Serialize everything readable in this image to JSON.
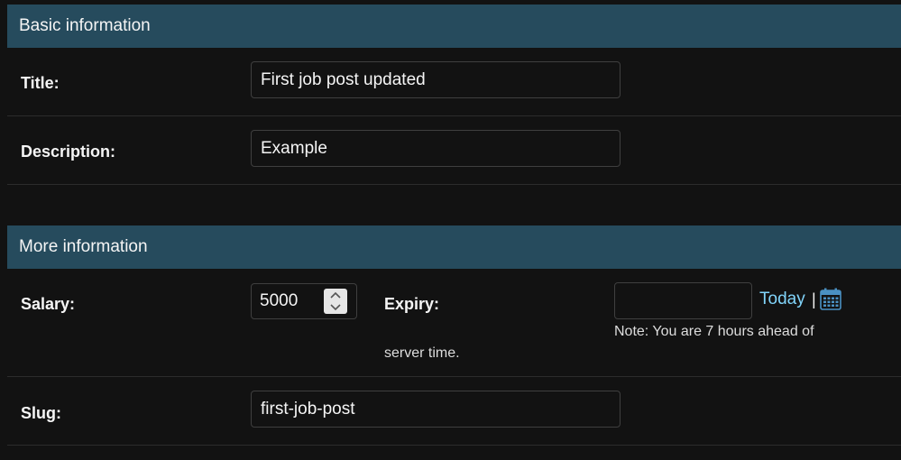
{
  "basic_section": {
    "title": "Basic information",
    "fields": {
      "title": {
        "label": "Title:",
        "value": "First job post updated"
      },
      "description": {
        "label": "Description:",
        "value": "Example"
      }
    }
  },
  "more_section": {
    "title": "More information",
    "fields": {
      "salary": {
        "label": "Salary:",
        "value": "5000"
      },
      "expiry": {
        "label": "Expiry:",
        "value": "",
        "today_link": "Today",
        "separator": "|",
        "note_line1": "Note: You are 7 hours ahead of",
        "note_line2": "server time."
      },
      "slug": {
        "label": "Slug:",
        "value": "first-job-post"
      }
    }
  },
  "colors": {
    "header_bg": "#264b5d",
    "page_bg": "#121212",
    "link": "#81d4fa",
    "calendar_icon": "#4a90c2"
  }
}
